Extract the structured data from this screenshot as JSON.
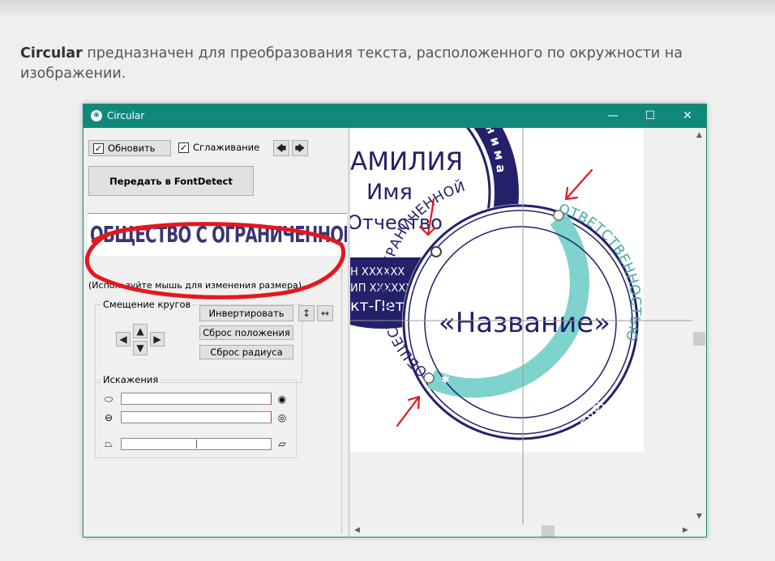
{
  "intro": {
    "brand": "Circular",
    "text": " предназначен для преобразования текста, расположенного по окружности на изображении."
  },
  "window": {
    "title": "Circular",
    "controls": {
      "minimize": "—",
      "maximize": "☐",
      "close": "✕"
    }
  },
  "toolbar": {
    "refresh": {
      "label": "Обновить",
      "checked": true
    },
    "smoothing": {
      "label": "Сглаживание",
      "checked": true
    },
    "send_button": "Передать в FontDetect",
    "arrow_left": "🡄",
    "arrow_right": "🡆"
  },
  "preview": {
    "text": "ОБЩЕСТВО С ОГРАНИЧЕННОЙ",
    "hint": "(Используйте мышь для изменения размера)"
  },
  "offset_group": {
    "title": "Смещение кругов",
    "invert_button": "Инвертировать",
    "reset_position_button": "Сброс положения",
    "reset_radius_button": "Сброс радиуса"
  },
  "distortion_group": {
    "title": "Искажения"
  },
  "stamp": {
    "back_lines": [
      "АМИЛИЯ",
      "Имя",
      "Отчество"
    ],
    "back_ring_text": "п р и н и м а",
    "back_small_1": "Н XXXXXX",
    "back_small_2": "ИП XXXXXX",
    "back_small_3": "кт-Пет",
    "outer_top": "ОБЩЕСТВО С ОГРАНИЧЕННОЙ",
    "outer_right": "ОТВЕТСТВЕННОСТЬЮ",
    "outer_bottom": "САНКТ-ПЕТЕРБУРГ",
    "center": "«Название»",
    "star": "✱"
  },
  "colors": {
    "titlebar": "#10897b",
    "stamp_blue": "#24206a",
    "ring_teal": "#7ed3cc",
    "annotation_red": "#e5171f"
  }
}
